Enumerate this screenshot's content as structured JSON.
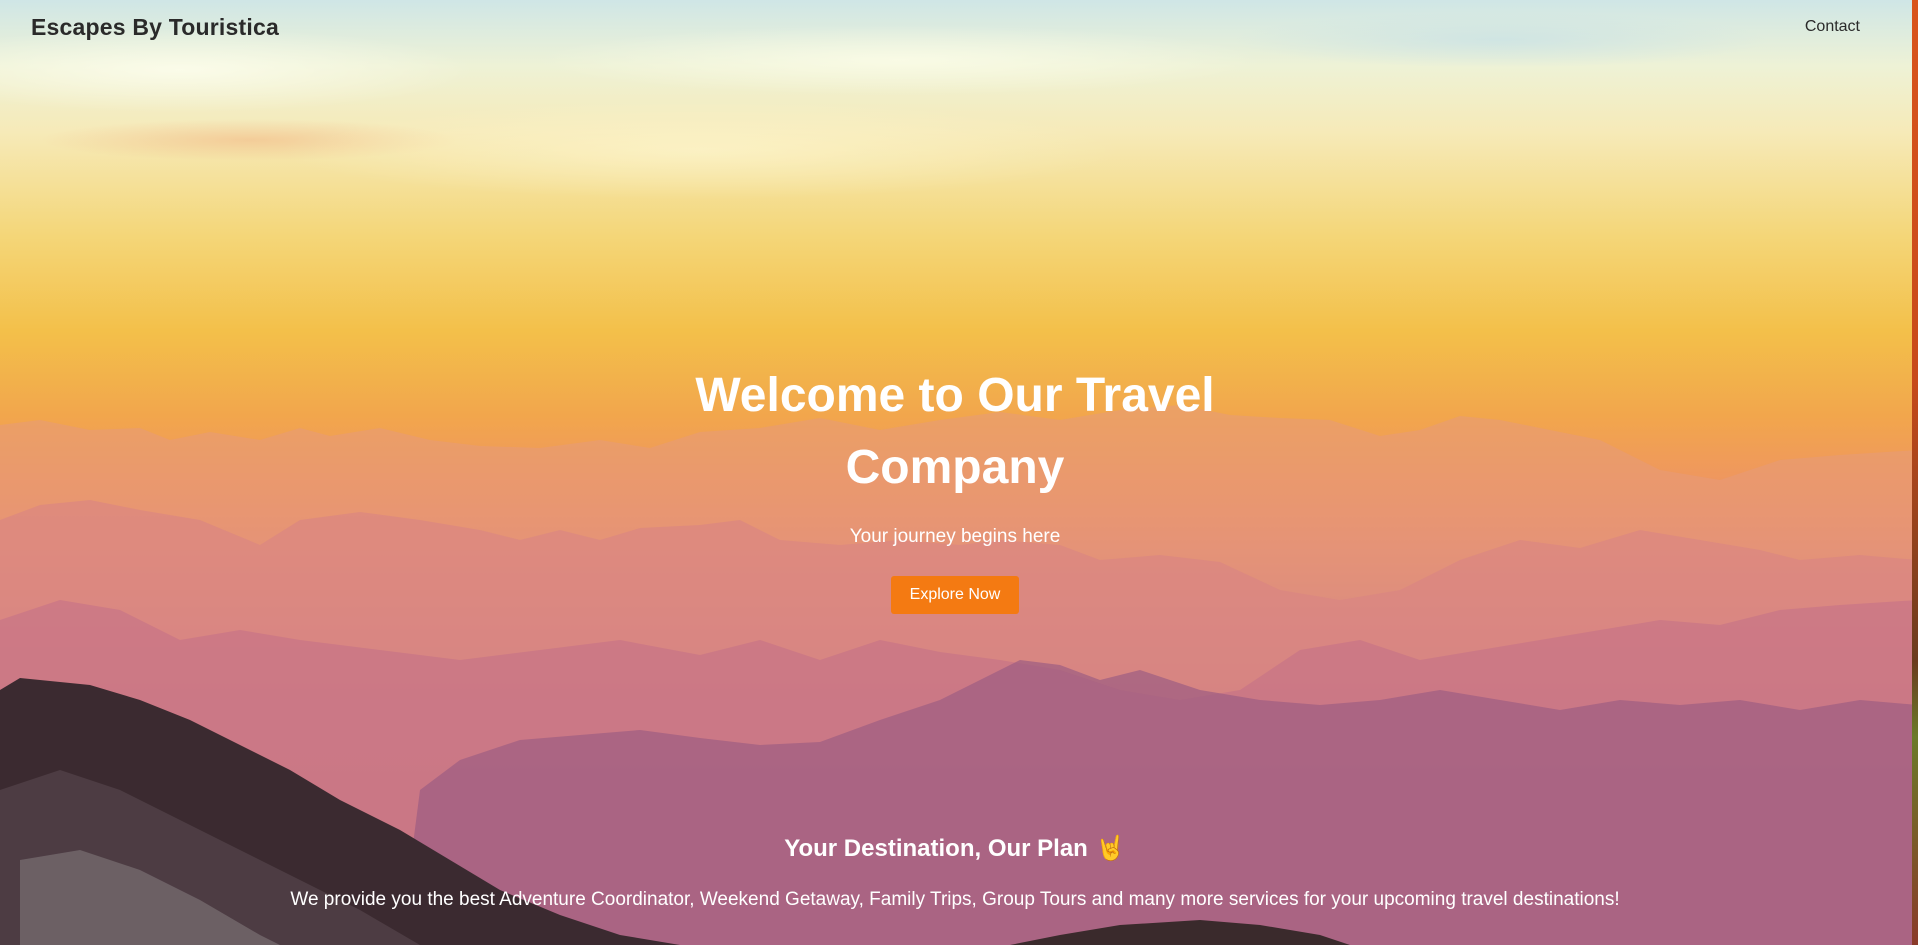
{
  "navbar": {
    "brand": "Escapes By Touristica",
    "links": [
      {
        "label": "Contact"
      }
    ]
  },
  "hero": {
    "title": "Welcome to Our Travel Company",
    "subtitle": "Your journey begins here",
    "cta_label": "Explore Now"
  },
  "about": {
    "heading": "Your Destination, Our Plan",
    "heading_emoji": "🤘",
    "text": "We provide you the best Adventure Coordinator, Weekend Getaway, Family Trips, Group Tours and many more services for your upcoming travel destinations!"
  },
  "colors": {
    "accent": "#f47a12",
    "text_dark": "#2a2a2a",
    "text_light": "#ffffff"
  }
}
